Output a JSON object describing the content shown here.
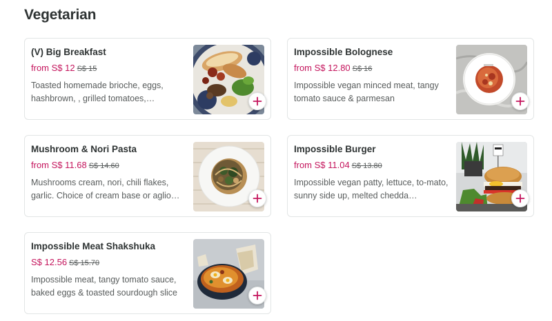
{
  "section": {
    "title": "Vegetarian"
  },
  "colors": {
    "price": "#c4145c",
    "text": "#2e3333",
    "muted": "#585c5c",
    "border": "#e2e5e5"
  },
  "items": [
    {
      "name": "(V) Big Breakfast",
      "price": "from S$ 12",
      "old_price": "S$ 15",
      "description": "Toasted homemade brioche, eggs, hashbrown, , grilled tomatoes,…",
      "image": "big-breakfast-image",
      "add_icon": "plus-icon"
    },
    {
      "name": "Impossible Bolognese",
      "price": "from S$ 12.80",
      "old_price": "S$ 16",
      "description": "Impossible vegan minced meat, tangy tomato sauce & parmesan",
      "image": "bolognese-image",
      "add_icon": "plus-icon"
    },
    {
      "name": "Mushroom & Nori Pasta",
      "price": "from S$ 11.68",
      "old_price": "S$ 14.60",
      "description": "Mushrooms cream, nori, chili flakes, garlic. Choice of cream base or aglio…",
      "image": "nori-pasta-image",
      "add_icon": "plus-icon"
    },
    {
      "name": "Impossible Burger",
      "price": "from S$ 11.04",
      "old_price": "S$ 13.80",
      "description": "Impossible vegan patty, lettuce, to-mato, sunny side up, melted chedda…",
      "image": "burger-image",
      "add_icon": "plus-icon"
    },
    {
      "name": "Impossible Meat Shakshuka",
      "price": "S$ 12.56",
      "old_price": "S$ 15.70",
      "description": "Impossible meat, tangy tomato sauce, baked eggs & toasted sourdough slice",
      "image": "shakshuka-image",
      "add_icon": "plus-icon"
    }
  ]
}
